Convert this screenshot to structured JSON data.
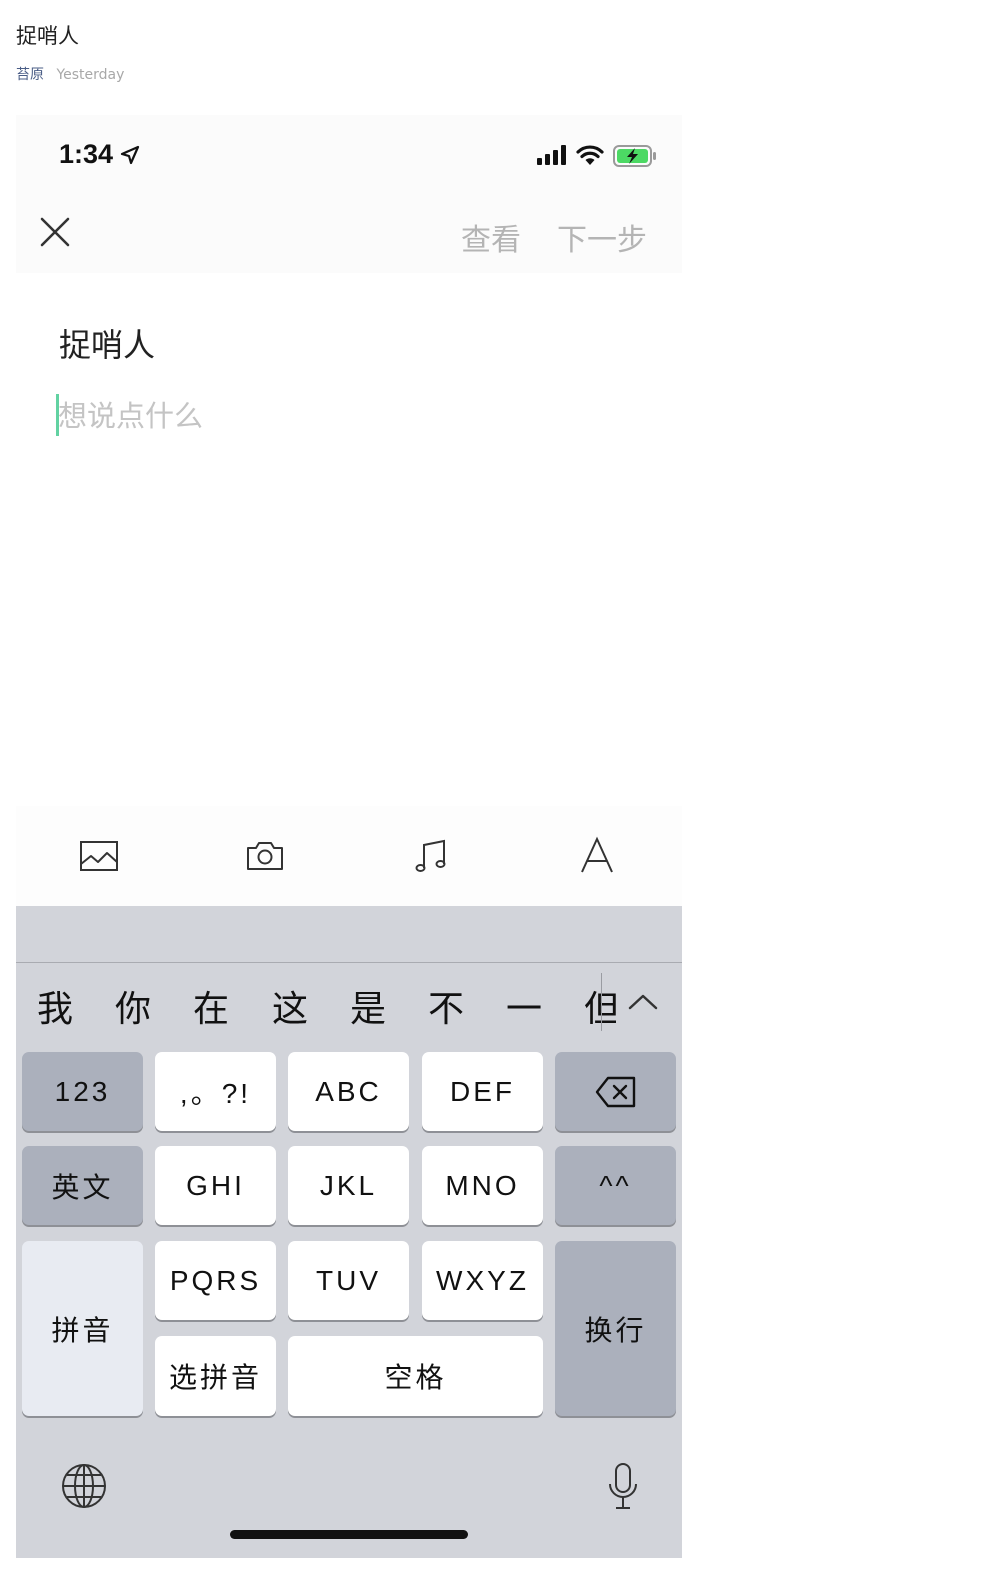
{
  "post": {
    "title": "捉哨人",
    "author": "苔原",
    "time": "Yesterday"
  },
  "status_bar": {
    "time": "1:34"
  },
  "nav": {
    "view_label": "查看",
    "next_label": "下一步"
  },
  "editor": {
    "title": "捉哨人",
    "placeholder": "想说点什么"
  },
  "toolbar": {
    "items": [
      "image-icon",
      "camera-icon",
      "music-icon",
      "text-format-icon"
    ]
  },
  "keyboard": {
    "candidates": [
      "我",
      "你",
      "在",
      "这",
      "是",
      "不",
      "一",
      "但"
    ],
    "keys": {
      "num": "123",
      "punct": ",。?!",
      "abc": "ABC",
      "def": "DEF",
      "english": "英文",
      "ghi": "GHI",
      "jkl": "JKL",
      "mno": "MNO",
      "emoticon": "^^",
      "pinyin": "拼音",
      "pqrs": "PQRS",
      "tuv": "TUV",
      "wxyz": "WXYZ",
      "enter": "换行",
      "select_pinyin": "选拼音",
      "space": "空格"
    }
  },
  "colors": {
    "caret": "#62d2a2",
    "author_link": "#4a5d86",
    "battery": "#4cd964"
  }
}
